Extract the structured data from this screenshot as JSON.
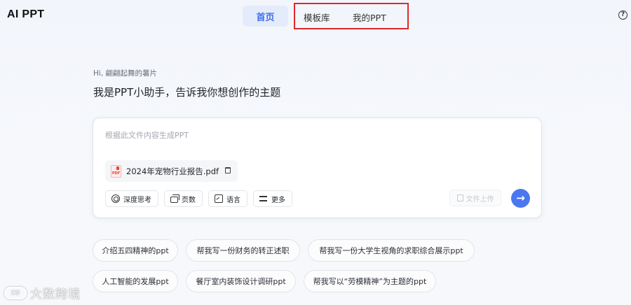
{
  "app": {
    "logo": "AI PPT"
  },
  "nav": {
    "home": "首页",
    "templates": "模板库",
    "my_ppt": "我的PPT",
    "help_icon": "help-circle-icon"
  },
  "main": {
    "greeting": "Hi, 翩翩起舞的薯片",
    "headline": "我是PPT小助手，告诉我你想创作的主题"
  },
  "input": {
    "placeholder": "根据此文件内容生成PPT",
    "file_badge": "PDF",
    "file_name": "2024年宠物行业报告.pdf"
  },
  "tools": {
    "deep_think": "深度思考",
    "pages": "页数",
    "language": "语言",
    "more": "更多",
    "upload": "文件上传",
    "send_icon": "arrow-right-icon"
  },
  "suggestions": [
    "介绍五四精神的ppt",
    "帮我写一份财务的转正述职",
    "帮我写一份大学生视角的求职综合展示ppt",
    "人工智能的发展ppt",
    "餐厅室内装饰设计调研ppt",
    "帮我写以“劳模精神”为主题的ppt"
  ],
  "watermark": {
    "text": "大数跨境",
    "logo": "CO"
  },
  "colors": {
    "accent": "#4b78ef",
    "nav_active_bg": "#e4ecfb",
    "highlight": "#e0272d"
  }
}
